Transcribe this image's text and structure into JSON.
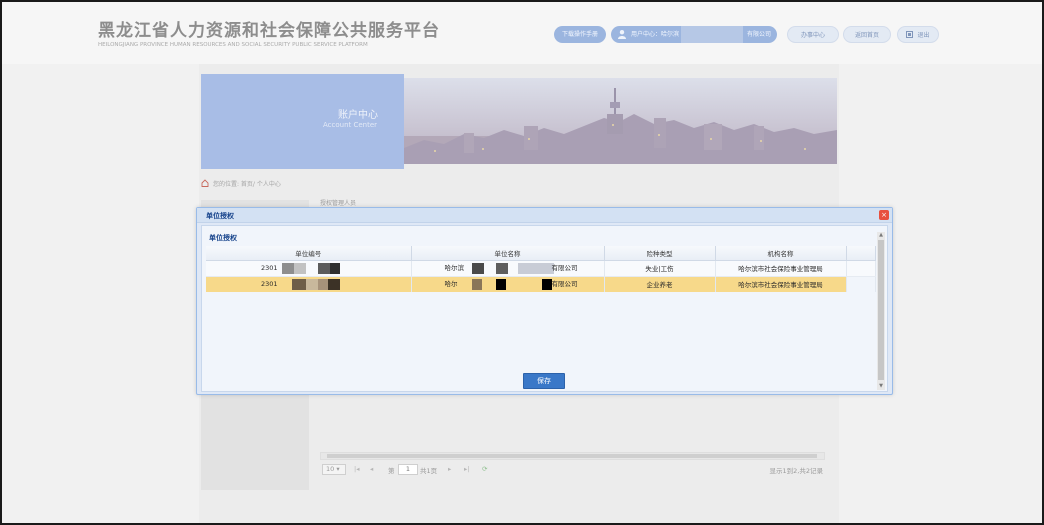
{
  "header": {
    "site_title_cn": "黑龙江省人力资源和社会保障公共服务平台",
    "site_title_en": "HEILONGJIANG PROVINCE HUMAN RESOURCES AND SOCIAL SECURITY PUBLIC SERVICE PLATFORM",
    "download_label": "下载操作手册",
    "user_prefix": "用户中心：哈尔滨",
    "user_suffix": "有限公司",
    "nav": [
      "办事中心",
      "返回首页",
      "退出"
    ]
  },
  "banner": {
    "title_cn": "账户中心",
    "title_en": "Account Center"
  },
  "breadcrumb": "您的位置: 首页/ 个人中心",
  "under_panel_title": "授权管理人员",
  "pager": {
    "page_size": "10",
    "page_prefix": "第",
    "current_page": "1",
    "page_suffix": "共1页",
    "info": "显示1到2,共2记录"
  },
  "modal": {
    "title": "单位授权",
    "section_title": "单位授权",
    "close_symbol": "×",
    "save_label": "保存",
    "columns": [
      "单位编号",
      "单位名称",
      "险种类型",
      "机构名称"
    ],
    "rows": [
      {
        "unit_no": "2301",
        "unit_name_start": "哈尔滨",
        "unit_name_end": "有限公司",
        "insurance_type": "失业|工伤",
        "agency": "哈尔滨市社会保险事业管理局",
        "selected": false
      },
      {
        "unit_no": "2301",
        "unit_name_start": "哈尔",
        "unit_name_end": "有限公司",
        "insurance_type": "企业养老",
        "agency": "哈尔滨市社会保险事业管理局",
        "selected": true
      }
    ]
  },
  "colors": {
    "primary": "#3a78c8",
    "selected_row": "#f7d98a",
    "modal_bg": "#dfe8f6",
    "header_pill": "#9bb5df",
    "close": "#e8503e"
  }
}
